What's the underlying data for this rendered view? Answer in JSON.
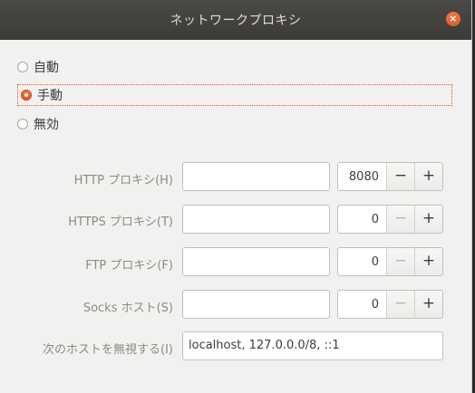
{
  "window": {
    "title": "ネットワークプロキシ",
    "close_glyph": "×"
  },
  "mode": {
    "options": [
      {
        "label": "自動",
        "selected": false
      },
      {
        "label": "手動",
        "selected": true
      },
      {
        "label": "無効",
        "selected": false
      }
    ]
  },
  "proxies": [
    {
      "label": "HTTP プロキシ(H)",
      "host": "",
      "port": "8080",
      "minus": "−",
      "plus": "+",
      "minus_disabled": false
    },
    {
      "label": "HTTPS プロキシ(T)",
      "host": "",
      "port": "0",
      "minus": "−",
      "plus": "+",
      "minus_disabled": true
    },
    {
      "label": "FTP プロキシ(F)",
      "host": "",
      "port": "0",
      "minus": "−",
      "plus": "+",
      "minus_disabled": true
    },
    {
      "label": "Socks ホスト(S)",
      "host": "",
      "port": "0",
      "minus": "−",
      "plus": "+",
      "minus_disabled": true
    }
  ],
  "ignore": {
    "label": "次のホストを無視する(I)",
    "value": "localhost, 127.0.0.0/8, ::1"
  },
  "colors": {
    "accent": "#e95420",
    "titlebar": "#3c3b37",
    "background": "#f2f1f0"
  }
}
